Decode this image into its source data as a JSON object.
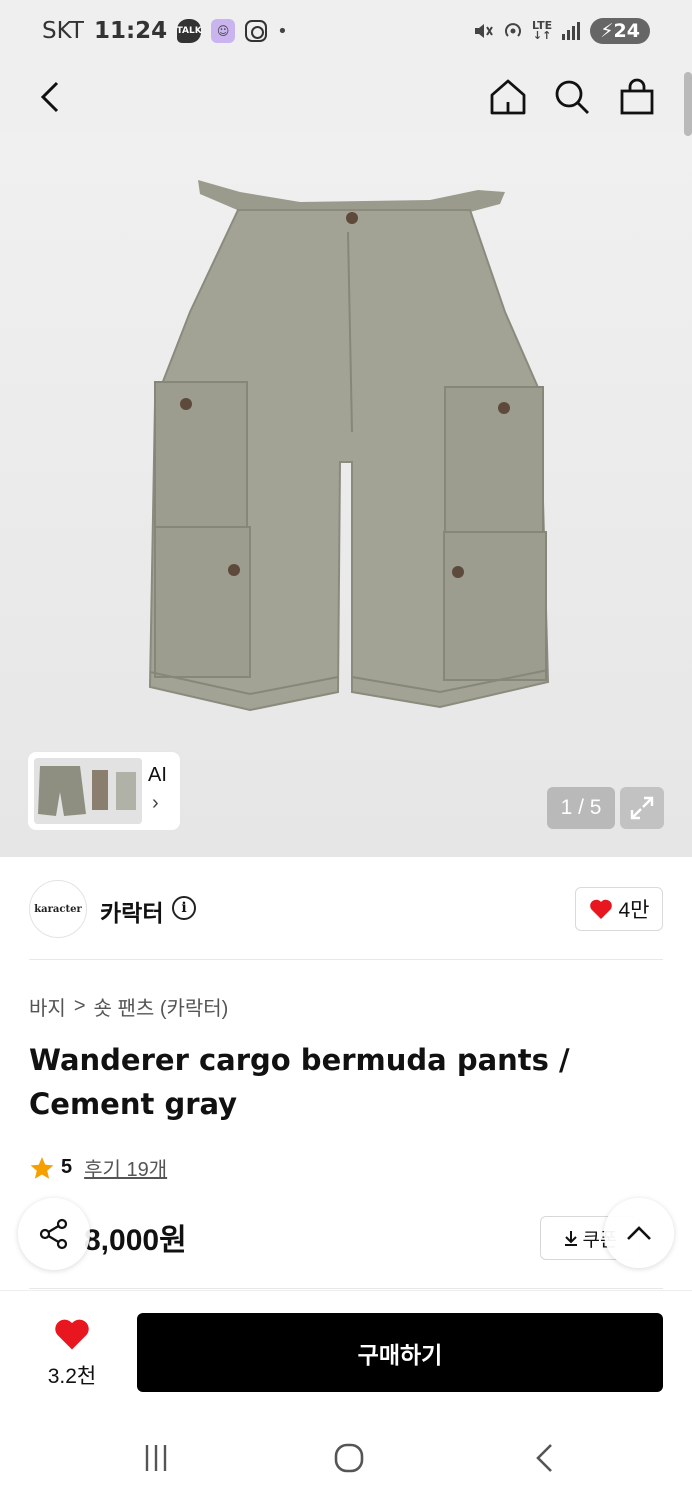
{
  "status_bar": {
    "carrier": "SKT",
    "time": "11:24",
    "battery": "24",
    "network": "LTE"
  },
  "header": {
    "icons": [
      "back-icon",
      "home-icon",
      "search-icon",
      "shopping-bag-icon"
    ]
  },
  "gallery": {
    "ai_label": "AI",
    "ai_chevron": "›",
    "page_counter": "1 / 5"
  },
  "brand": {
    "logo_text": "karacter",
    "name": "카락터",
    "info_glyph": "i",
    "likes": "4만"
  },
  "product": {
    "breadcrumb": [
      "바지",
      "숏 팬츠 (카락터)"
    ],
    "breadcrumb_separator": ">",
    "title": "Wanderer cargo bermuda pants / Cement gray",
    "rating_score": "5",
    "review_label": "후기 19개",
    "price_visible": "8,000원",
    "coupon_label": "쿠폰"
  },
  "action_bar": {
    "wish_count": "3.2천",
    "buy_label": "구매하기"
  },
  "colors": {
    "heart": "#e8171f",
    "star": "#f5a000",
    "buy_button": "#000000",
    "hero_bg": "#ececec"
  }
}
